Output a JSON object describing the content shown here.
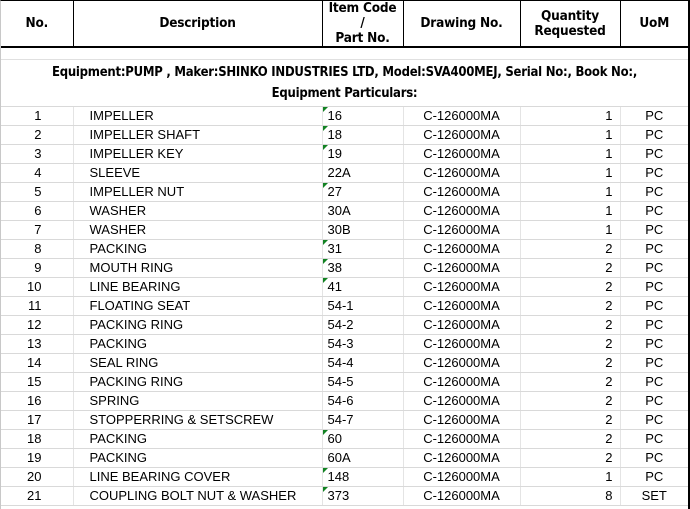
{
  "table": {
    "columns": [
      {
        "key": "no",
        "label": "No."
      },
      {
        "key": "desc",
        "label": "Description"
      },
      {
        "key": "item",
        "label": "Item Code /\nPart No."
      },
      {
        "key": "draw",
        "label": "Drawing No."
      },
      {
        "key": "qty",
        "label": "Quantity\nRequested"
      },
      {
        "key": "uom",
        "label": "UoM"
      }
    ],
    "header_lines": {
      "no": "No.",
      "desc": "Description",
      "item_l1": "Item Code /",
      "item_l2": "Part No.",
      "draw": "Drawing No.",
      "qty_l1": "Quantity",
      "qty_l2": "Requested",
      "uom": "UoM"
    },
    "equipment_banner": "Equipment:PUMP , Maker:SHINKO INDUSTRIES LTD, Model:SVA400MEJ, Serial No:, Book No:, Equipment Particulars:",
    "rows": [
      {
        "no": "1",
        "desc": "IMPELLER",
        "item": "16",
        "flag": true,
        "draw": "C-126000MA",
        "qty": "1",
        "uom": "PC"
      },
      {
        "no": "2",
        "desc": "IMPELLER SHAFT",
        "item": "18",
        "flag": true,
        "draw": "C-126000MA",
        "qty": "1",
        "uom": "PC"
      },
      {
        "no": "3",
        "desc": "IMPELLER KEY",
        "item": "19",
        "flag": true,
        "draw": "C-126000MA",
        "qty": "1",
        "uom": "PC"
      },
      {
        "no": "4",
        "desc": "SLEEVE",
        "item": "22A",
        "flag": false,
        "draw": "C-126000MA",
        "qty": "1",
        "uom": "PC"
      },
      {
        "no": "5",
        "desc": "IMPELLER NUT",
        "item": "27",
        "flag": true,
        "draw": "C-126000MA",
        "qty": "1",
        "uom": "PC"
      },
      {
        "no": "6",
        "desc": "WASHER",
        "item": "30A",
        "flag": false,
        "draw": "C-126000MA",
        "qty": "1",
        "uom": "PC"
      },
      {
        "no": "7",
        "desc": "WASHER",
        "item": "30B",
        "flag": false,
        "draw": "C-126000MA",
        "qty": "1",
        "uom": "PC"
      },
      {
        "no": "8",
        "desc": "PACKING",
        "item": "31",
        "flag": true,
        "draw": "C-126000MA",
        "qty": "2",
        "uom": "PC"
      },
      {
        "no": "9",
        "desc": "MOUTH RING",
        "item": "38",
        "flag": true,
        "draw": "C-126000MA",
        "qty": "2",
        "uom": "PC"
      },
      {
        "no": "10",
        "desc": "LINE BEARING",
        "item": "41",
        "flag": true,
        "draw": "C-126000MA",
        "qty": "2",
        "uom": "PC"
      },
      {
        "no": "11",
        "desc": "FLOATING SEAT",
        "item": "54-1",
        "flag": false,
        "draw": "C-126000MA",
        "qty": "2",
        "uom": "PC"
      },
      {
        "no": "12",
        "desc": "PACKING RING",
        "item": "54-2",
        "flag": false,
        "draw": "C-126000MA",
        "qty": "2",
        "uom": "PC"
      },
      {
        "no": "13",
        "desc": "PACKING",
        "item": "54-3",
        "flag": false,
        "draw": "C-126000MA",
        "qty": "2",
        "uom": "PC"
      },
      {
        "no": "14",
        "desc": "SEAL RING",
        "item": "54-4",
        "flag": false,
        "draw": "C-126000MA",
        "qty": "2",
        "uom": "PC"
      },
      {
        "no": "15",
        "desc": "PACKING RING",
        "item": "54-5",
        "flag": false,
        "draw": "C-126000MA",
        "qty": "2",
        "uom": "PC"
      },
      {
        "no": "16",
        "desc": "SPRING",
        "item": "54-6",
        "flag": false,
        "draw": "C-126000MA",
        "qty": "2",
        "uom": "PC"
      },
      {
        "no": "17",
        "desc": "STOPPERRING & SETSCREW",
        "item": "54-7",
        "flag": false,
        "draw": "C-126000MA",
        "qty": "2",
        "uom": "PC"
      },
      {
        "no": "18",
        "desc": "PACKING",
        "item": "60",
        "flag": true,
        "draw": "C-126000MA",
        "qty": "2",
        "uom": "PC"
      },
      {
        "no": "19",
        "desc": "PACKING",
        "item": "60A",
        "flag": false,
        "draw": "C-126000MA",
        "qty": "2",
        "uom": "PC"
      },
      {
        "no": "20",
        "desc": "LINE BEARING COVER",
        "item": "148",
        "flag": true,
        "draw": "C-126000MA",
        "qty": "1",
        "uom": "PC"
      },
      {
        "no": "21",
        "desc": "COUPLING BOLT NUT & WASHER",
        "item": "373",
        "flag": true,
        "draw": "C-126000MA",
        "qty": "8",
        "uom": "SET"
      }
    ]
  },
  "colors": {
    "grid_line": "#d9d9d9",
    "header_border": "#000000",
    "error_flag": "#128223",
    "text": "#000000",
    "background": "#ffffff"
  },
  "icons": {
    "error_flag": "green-triangle-error-icon"
  }
}
